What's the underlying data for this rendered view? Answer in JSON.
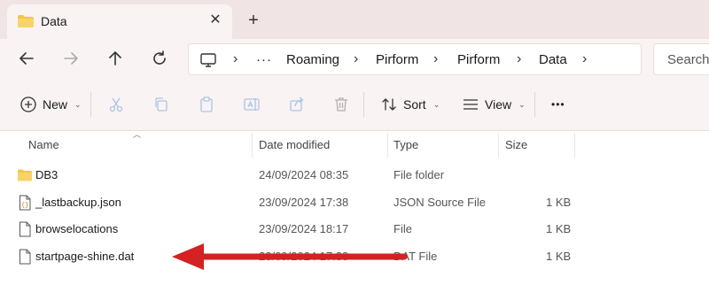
{
  "tab": {
    "title": "Data",
    "close": "✕",
    "new_tab": "+"
  },
  "address": {
    "crumbs": [
      "Roaming",
      "Pirform",
      "Pirform",
      "Data"
    ],
    "overflow": "···",
    "search_placeholder": "Search"
  },
  "commands": {
    "new_label": "New",
    "sort_label": "Sort",
    "view_label": "View",
    "more": "•••"
  },
  "columns": {
    "name": "Name",
    "date": "Date modified",
    "type": "Type",
    "size": "Size"
  },
  "files": [
    {
      "name": "DB3",
      "date": "24/09/2024 08:35",
      "type": "File folder",
      "size": "",
      "icon": "folder-icon"
    },
    {
      "name": "_lastbackup.json",
      "date": "23/09/2024 17:38",
      "type": "JSON Source File",
      "size": "1 KB",
      "icon": "json-file-icon"
    },
    {
      "name": "browselocations",
      "date": "23/09/2024 18:17",
      "type": "File",
      "size": "1 KB",
      "icon": "file-icon"
    },
    {
      "name": "startpage-shine.dat",
      "date": "23/09/2024 17:38",
      "type": "DAT File",
      "size": "1 KB",
      "icon": "file-icon"
    }
  ],
  "colors": {
    "accent_folder": "#f4c54a",
    "arrow": "#d42121",
    "chrome_bg": "#f9f3f3",
    "tabstrip_bg": "#f1e4e4"
  }
}
